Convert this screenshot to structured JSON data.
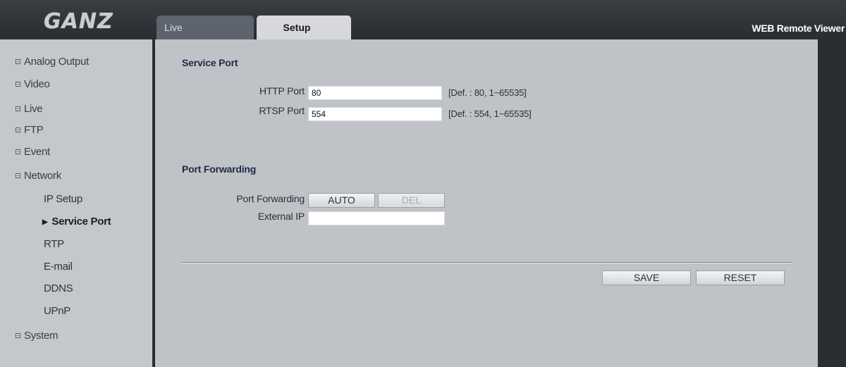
{
  "header": {
    "logo_text": "GANZ",
    "app_title": "WEB Remote Viewer",
    "tabs": [
      {
        "label": "Live",
        "active": false
      },
      {
        "label": "Setup",
        "active": true
      }
    ]
  },
  "sidebar": {
    "items": [
      {
        "label": "Analog Output"
      },
      {
        "label": "Video"
      },
      {
        "label": "Live"
      },
      {
        "label": "FTP"
      },
      {
        "label": "Event"
      },
      {
        "label": "Network",
        "expanded": true
      }
    ],
    "network_subitems": [
      {
        "label": "IP Setup"
      },
      {
        "label": "Service Port",
        "active": true
      },
      {
        "label": "RTP"
      },
      {
        "label": "E-mail"
      },
      {
        "label": "DDNS"
      },
      {
        "label": "UPnP"
      }
    ],
    "last_item": {
      "label": "System"
    }
  },
  "service_port": {
    "title": "Service Port",
    "http": {
      "label": "HTTP Port",
      "value": "80",
      "hint": "[Def. : 80, 1~65535]"
    },
    "rtsp": {
      "label": "RTSP Port",
      "value": "554",
      "hint": "[Def. : 554, 1~65535]"
    }
  },
  "port_forwarding": {
    "title": "Port Forwarding",
    "label": "Port Forwarding",
    "auto_label": "AUTO",
    "del_label": "DEL",
    "external_ip_label": "External IP",
    "external_ip_value": ""
  },
  "actions": {
    "save_label": "SAVE",
    "reset_label": "RESET"
  },
  "colors": {
    "sidebar_bg": "#c4c7cc",
    "main_bg": "#bfc3c8",
    "frame_bg": "#2a2d31",
    "section_title": "#1d2a42"
  }
}
